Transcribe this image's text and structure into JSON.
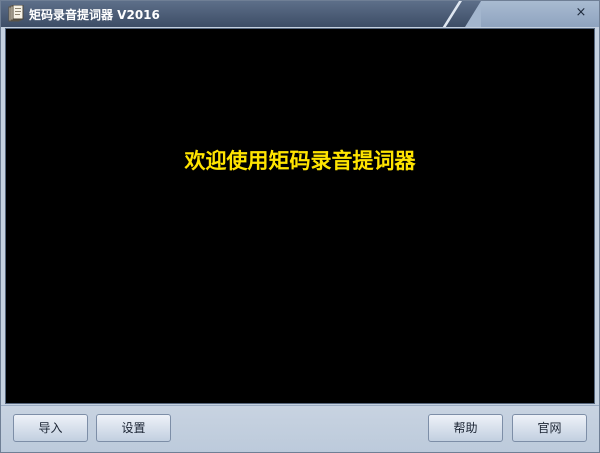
{
  "window": {
    "title": "矩码录音提词器 V2016",
    "close_glyph": "×"
  },
  "display": {
    "message": "欢迎使用矩码录音提词器",
    "text_color": "#ffe400",
    "background": "#000000"
  },
  "buttons": {
    "import_label": "导入",
    "settings_label": "设置",
    "help_label": "帮助",
    "website_label": "官网"
  },
  "icons": {
    "app": "app-book-icon",
    "close": "close-icon"
  }
}
